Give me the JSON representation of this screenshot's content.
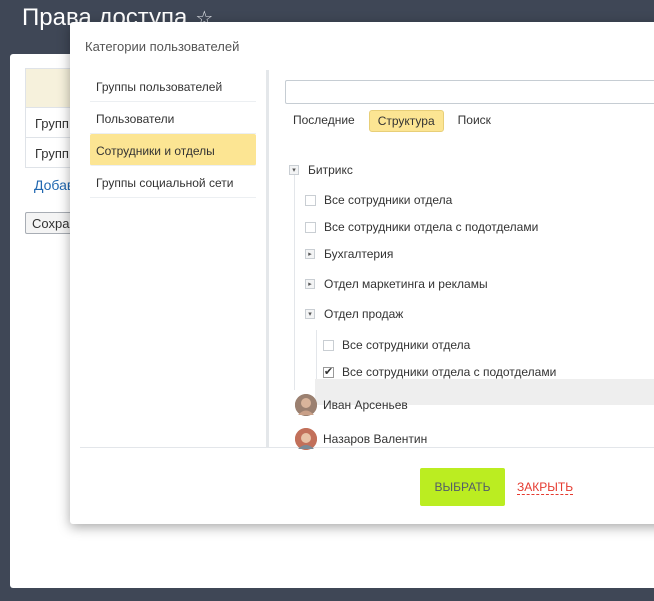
{
  "page": {
    "title": "Права доступа",
    "bg_table_rows": [
      "Групп",
      "Групп"
    ],
    "bg_add_link": "Добав",
    "bg_save_button": "Сохра"
  },
  "dialog": {
    "title": "Категории пользователей",
    "nav": [
      "Группы пользователей",
      "Пользователи",
      "Сотрудники и отделы",
      "Группы социальной сети"
    ],
    "nav_active_index": 2,
    "search": {
      "value": "",
      "placeholder": ""
    },
    "tabs": [
      "Последние",
      "Структура",
      "Поиск"
    ],
    "active_tab": "Структура",
    "tree": {
      "root": "Битрикс",
      "root_all": "Все сотрудники отдела",
      "root_all_sub": "Все сотрудники отдела с подотделами",
      "dept1": "Бухгалтерия",
      "dept2": "Отдел маркетинга и рекламы",
      "dept3": "Отдел продаж",
      "dept3_all": "Все сотрудники отдела",
      "dept3_all_sub": "Все сотрудники отдела с подотделами",
      "dept3_all_sub_checked": true,
      "user1": "Иван Арсеньев",
      "user2": "Назаров Валентин"
    },
    "buttons": {
      "select": "ВЫБРАТЬ",
      "close": "ЗАКРЫТЬ"
    }
  },
  "icons": {
    "star": "☆",
    "expand": "▸",
    "collapse": "▾",
    "check": "✔"
  },
  "colors": {
    "accent_yellow": "#fce593",
    "select_button": "#bbed21",
    "close_link": "#e53a2f",
    "background": "#3f4756"
  }
}
